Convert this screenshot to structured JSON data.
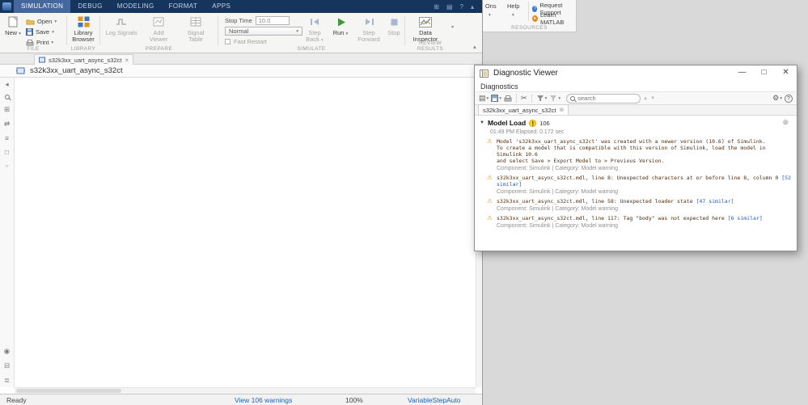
{
  "titlebar": {
    "tabs": [
      "SIMULATION",
      "DEBUG",
      "MODELING",
      "FORMAT",
      "APPS"
    ]
  },
  "toolstrip": {
    "file": {
      "label": "FILE",
      "new": "New",
      "open": "Open",
      "save": "Save",
      "print": "Print"
    },
    "library": {
      "label": "LIBRARY",
      "browser": "Library Browser"
    },
    "prepare": {
      "label": "PREPARE",
      "log_signals": "Log Signals",
      "add_viewer": "Add Viewer",
      "signal_table": "Signal Table"
    },
    "simulate": {
      "label": "SIMULATE",
      "stop_time_label": "Stop Time",
      "stop_time_value": "10.0",
      "mode": "Normal",
      "fast_restart": "Fast Restart",
      "step_back": "Step Back",
      "run": "Run",
      "step_forward": "Step Forward",
      "stop": "Stop"
    },
    "review": {
      "label": "REVIEW RESULTS",
      "data_inspector": "Data Inspector"
    }
  },
  "resources": {
    "label": "RESOURCES",
    "addons": "Add-Ons",
    "help": "Help",
    "request_support": "Request Support",
    "learn_matlab": "Learn MATLAB"
  },
  "editor": {
    "doc_tab": "s32k3xx_uart_async_s32ct",
    "breadcrumb": "s32k3xx_uart_async_s32ct"
  },
  "statusbar": {
    "ready": "Ready",
    "warnings": "View 106 warnings",
    "zoom": "100%",
    "solver": "VariableStepAuto"
  },
  "diagnostic": {
    "title": "Diagnostic Viewer",
    "menu": "Diagnostics",
    "search_placeholder": "search",
    "tab": "s32k3xx_uart_async_s32ct",
    "group": {
      "name": "Model Load",
      "count": "106",
      "time": "01:49 PM  Elapsed: 0.172 sec"
    },
    "messages": [
      {
        "text": "Model 's32k3xx_uart_async_s32ct' was created with a newer version (10.6) of Simulink.\nTo create a model that is compatible with this version of Simulink, load the model in Simulink 10.6\nand select Save > Export Model to > Previous Version.",
        "link": "",
        "meta": "Component: Simulink | Category: Model warning"
      },
      {
        "text": "s32k3xx_uart_async_s32ct.mdl, line 8: Unexpected characters at or before line 8, column 0",
        "link": "[52 similar]",
        "meta": "Component: Simulink | Category: Model warning"
      },
      {
        "text": "s32k3xx_uart_async_s32ct.mdl, line 58: Unexpected loader state",
        "link": "[47 similar]",
        "meta": "Component: Simulink | Category: Model warning"
      },
      {
        "text": "s32k3xx_uart_async_s32ct.mdl, line 117: Tag \"body\" was not expected here",
        "link": "[6 similar]",
        "meta": "Component: Simulink | Category: Model warning"
      }
    ]
  }
}
